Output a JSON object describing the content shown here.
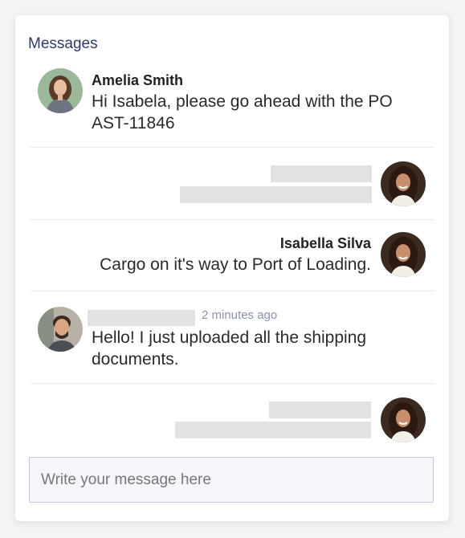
{
  "header": {
    "title": "Messages"
  },
  "messages": [
    {
      "sender": "Amelia Smith",
      "text": "Hi Isabela, please go ahead with the PO AST-11846",
      "side": "left",
      "avatar_icon": "woman-avatar-icon"
    },
    {
      "sender": "",
      "text": "",
      "side": "right",
      "redacted": true,
      "avatar_icon": "isabella-avatar-icon"
    },
    {
      "sender": "Isabella Silva",
      "text": "Cargo on it's way to Port of Loading.",
      "side": "right",
      "avatar_icon": "isabella-avatar-icon"
    },
    {
      "sender": "",
      "time": "2 minutes ago",
      "text": "Hello! I just uploaded all the shipping documents.",
      "side": "left",
      "avatar_icon": "man-avatar-icon"
    },
    {
      "sender": "",
      "text": "",
      "side": "right",
      "redacted": true,
      "avatar_icon": "isabella-avatar-icon"
    }
  ],
  "composer": {
    "placeholder": "Write your message here"
  },
  "colors": {
    "title": "#2d3a6b",
    "timestamp": "#8a93b3",
    "redaction": "#e2e2e2",
    "input_border": "#c5c8e0"
  }
}
